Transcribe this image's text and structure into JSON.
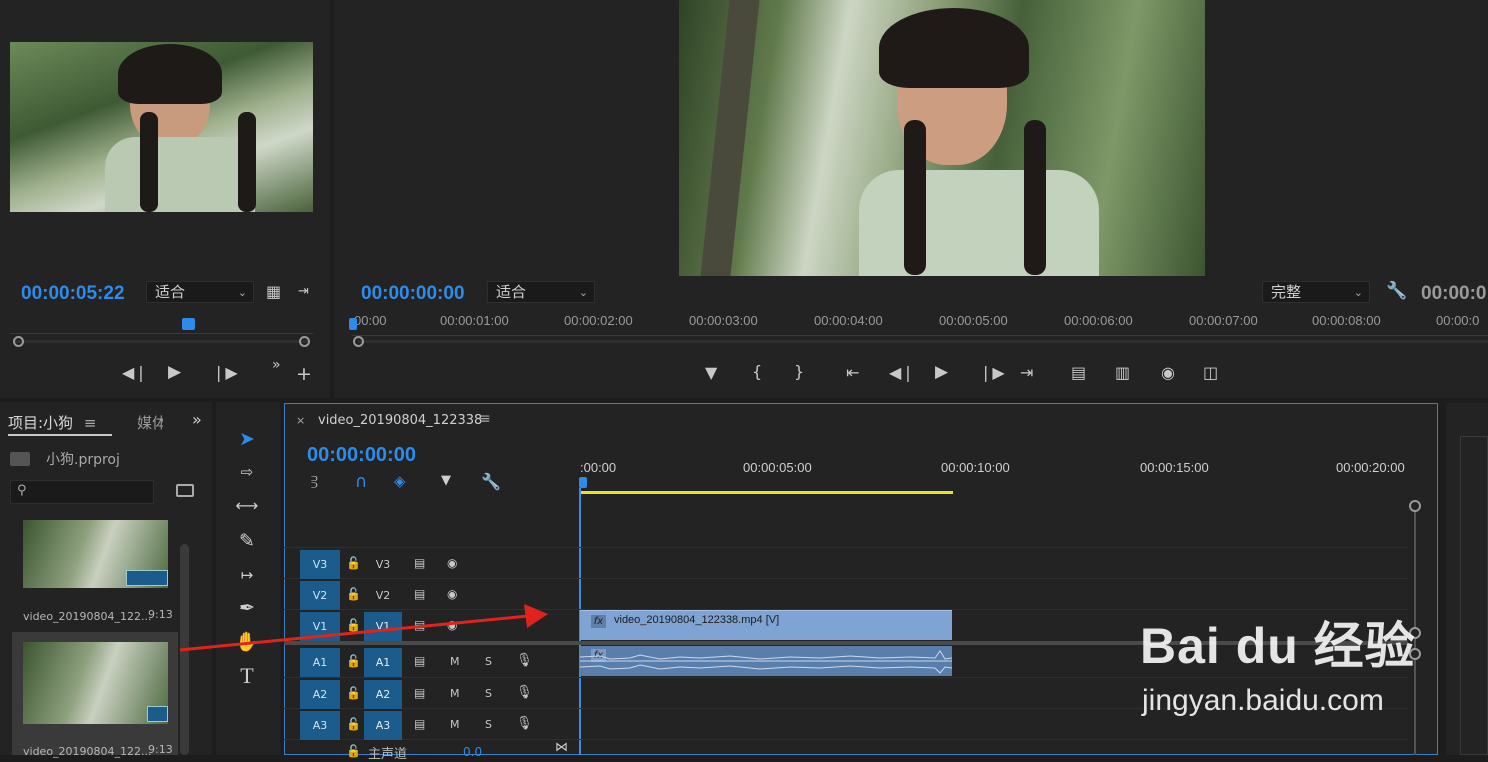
{
  "source_monitor": {
    "timecode": "00:00:05:22",
    "fit_label": "适合"
  },
  "program_monitor": {
    "timecode": "00:00:00:00",
    "fit_label": "适合",
    "quality_label": "完整",
    "right_timecode": "00:00:0",
    "ruler_labels": [
      "00:00",
      "00:00:01:00",
      "00:00:02:00",
      "00:00:03:00",
      "00:00:04:00",
      "00:00:05:00",
      "00:00:06:00",
      "00:00:07:00",
      "00:00:08:00",
      "00:00:0"
    ]
  },
  "project_panel": {
    "tab_label": "项目:小狗",
    "tab2_label": "媒体",
    "project_file": "小狗.prproj",
    "items": [
      {
        "name": "video_20190804_122...",
        "duration": "9:13"
      },
      {
        "name": "video_20190804_122...",
        "duration": "9:13"
      }
    ]
  },
  "timeline": {
    "tab_title": "video_20190804_122338",
    "timecode": "00:00:00:00",
    "ruler_labels": [
      ":00:00",
      "00:00:05:00",
      "00:00:10:00",
      "00:00:15:00",
      "00:00:20:00"
    ],
    "clip_video_label": "video_20190804_122338.mp4 [V]",
    "fx_label": "fx",
    "tracks": [
      {
        "id": "V3",
        "name": "V3"
      },
      {
        "id": "V2",
        "name": "V2"
      },
      {
        "id": "V1",
        "name": "V1"
      },
      {
        "id": "A1",
        "name": "A1"
      },
      {
        "id": "A2",
        "name": "A2"
      },
      {
        "id": "A3",
        "name": "A3"
      }
    ],
    "mute_label": "M",
    "solo_label": "S",
    "master_label": "主声道",
    "master_value": "0.0"
  },
  "watermark": {
    "brand": "Bai du 经验",
    "url": "jingyan.baidu.com"
  },
  "colors": {
    "accent_blue": "#2d8ceb",
    "track_blue": "#1b5c8c",
    "clip_blue": "#7fa3d3",
    "work_area_yellow": "#e8e31b",
    "arrow_red": "#e0231d"
  }
}
